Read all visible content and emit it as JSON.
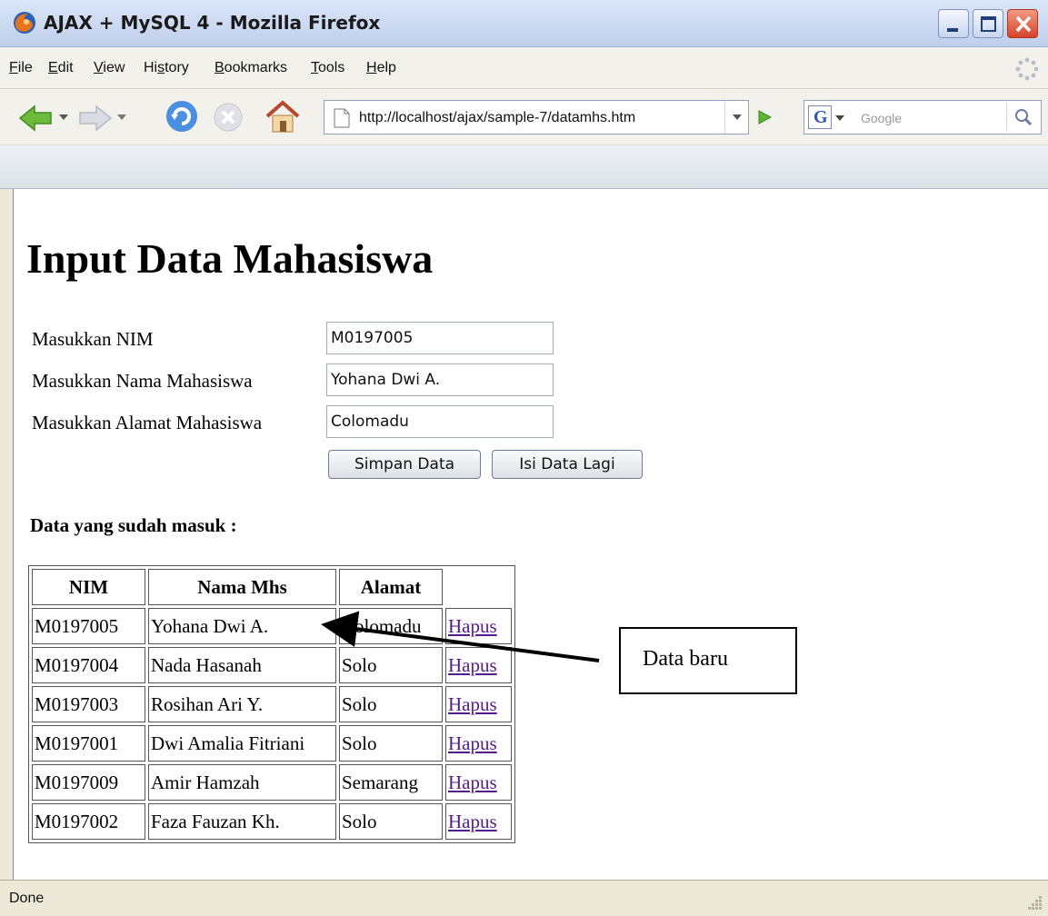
{
  "window": {
    "title": "AJAX + MySQL 4 - Mozilla Firefox"
  },
  "menu": [
    {
      "label": "File",
      "accel": "F",
      "rest": "ile"
    },
    {
      "label": "Edit",
      "accel": "E",
      "rest": "dit"
    },
    {
      "label": "View",
      "accel": "V",
      "rest": "iew"
    },
    {
      "label": "History",
      "pre": "Hi",
      "accel": "s",
      "rest": "tory"
    },
    {
      "label": "Bookmarks",
      "accel": "B",
      "rest": "ookmarks"
    },
    {
      "label": "Tools",
      "accel": "T",
      "rest": "ools"
    },
    {
      "label": "Help",
      "accel": "H",
      "rest": "elp"
    }
  ],
  "navigation": {
    "url": "http://localhost/ajax/sample-7/datamhs.htm",
    "search_engine_letter": "G",
    "search_placeholder": "Google"
  },
  "page": {
    "title": "Input Data Mahasiswa",
    "form": {
      "nim_label": "Masukkan NIM",
      "nim_value": "M0197005",
      "nama_label": "Masukkan Nama Mahasiswa",
      "nama_value": "Yohana Dwi A.",
      "alamat_label": "Masukkan Alamat Mahasiswa",
      "alamat_value": "Colomadu",
      "save_button": "Simpan Data",
      "reset_button": "Isi Data Lagi"
    },
    "list_heading": "Data yang sudah masuk :",
    "table": {
      "headers": [
        "NIM",
        "Nama Mhs",
        "Alamat"
      ],
      "action_label": "Hapus",
      "rows": [
        [
          "M0197005",
          "Yohana Dwi A.",
          "Colomadu"
        ],
        [
          "M0197004",
          "Nada Hasanah",
          "Solo"
        ],
        [
          "M0197003",
          "Rosihan Ari Y.",
          "Solo"
        ],
        [
          "M0197001",
          "Dwi Amalia Fitriani",
          "Solo"
        ],
        [
          "M0197009",
          "Amir Hamzah",
          "Semarang"
        ],
        [
          "M0197002",
          "Faza Fauzan Kh.",
          "Solo"
        ]
      ]
    },
    "annotation": "Data baru"
  },
  "status": {
    "text": "Done"
  },
  "colors": {
    "link_visited": "#551a8b",
    "close_button": "#d6432a",
    "titlebar": "#cfdcf3"
  }
}
